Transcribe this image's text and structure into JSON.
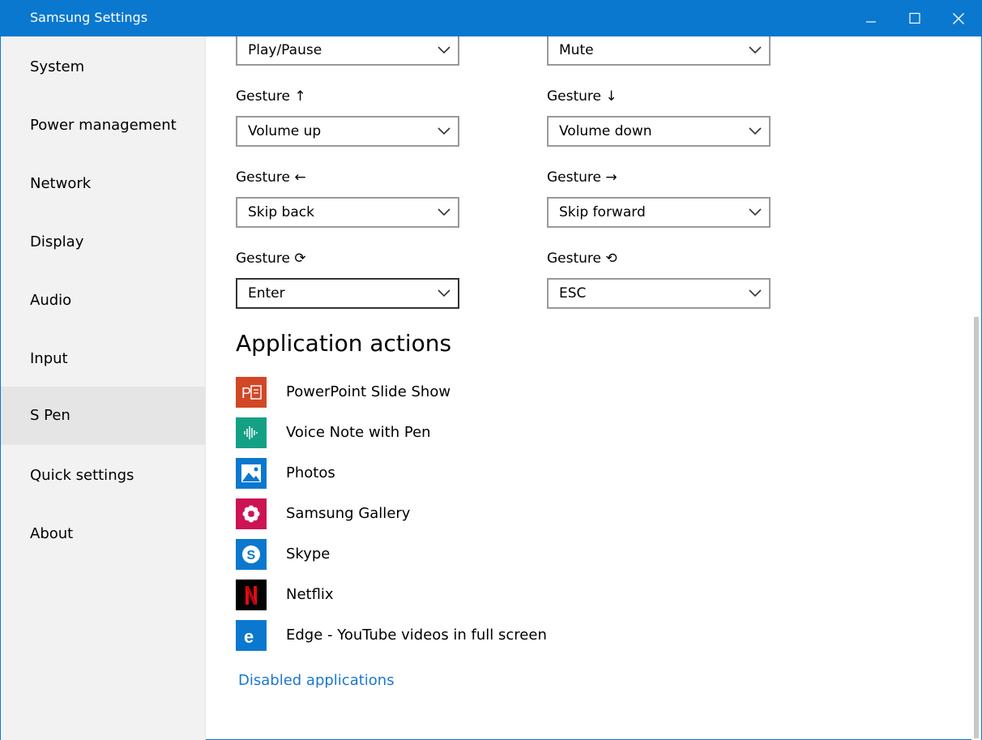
{
  "window": {
    "title": "Samsung Settings"
  },
  "sidebar": {
    "items": [
      {
        "label": "System"
      },
      {
        "label": "Power management"
      },
      {
        "label": "Network"
      },
      {
        "label": "Display"
      },
      {
        "label": "Audio"
      },
      {
        "label": "Input"
      },
      {
        "label": "S Pen",
        "active": true
      },
      {
        "label": "Quick settings"
      },
      {
        "label": "About"
      }
    ]
  },
  "gestures": {
    "top_left_value": "Play/Pause",
    "top_right_value": "Mute",
    "rows": [
      {
        "left_label": "Gesture ↑",
        "left_value": "Volume up",
        "right_label": "Gesture ↓",
        "right_value": "Volume down"
      },
      {
        "left_label": "Gesture ←",
        "left_value": "Skip back",
        "right_label": "Gesture →",
        "right_value": "Skip forward"
      },
      {
        "left_label": "Gesture ⟳",
        "left_value": "Enter",
        "right_label": "Gesture ⟲",
        "right_value": "ESC"
      }
    ]
  },
  "application_actions": {
    "title": "Application actions",
    "apps": [
      {
        "label": "PowerPoint Slide Show",
        "icon": "powerpoint-icon",
        "color": "#d24726"
      },
      {
        "label": "Voice Note with Pen",
        "icon": "voice-note-icon",
        "color": "#14a085"
      },
      {
        "label": "Photos",
        "icon": "photos-icon",
        "color": "#0a78cf"
      },
      {
        "label": "Samsung Gallery",
        "icon": "gallery-flower-icon",
        "color": "#cc1353"
      },
      {
        "label": "Skype",
        "icon": "skype-icon",
        "color": "#0a78cf"
      },
      {
        "label": "Netflix",
        "icon": "netflix-icon",
        "color": "#000000"
      },
      {
        "label": "Edge - YouTube videos in full screen",
        "icon": "edge-icon",
        "color": "#0a78cf"
      }
    ],
    "disabled_link": "Disabled applications"
  },
  "colors": {
    "accent": "#0a78cf",
    "link": "#1a78cf",
    "sidebar_bg": "#f2f2f2"
  }
}
